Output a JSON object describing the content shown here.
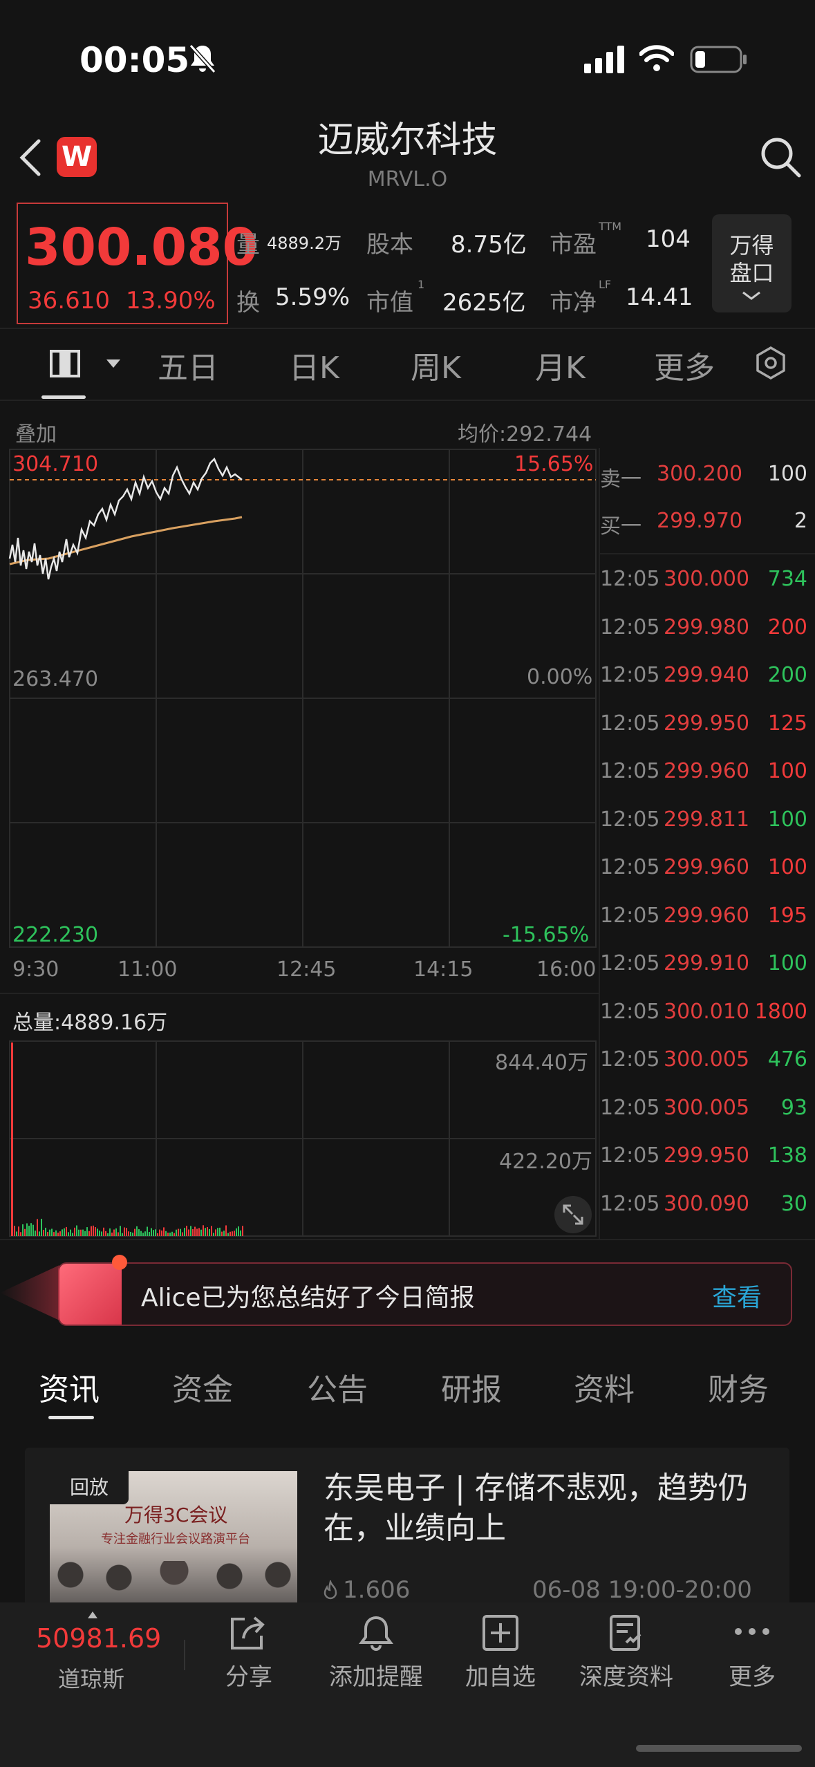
{
  "status": {
    "time": "00:05"
  },
  "header": {
    "title": "迈威尔科技",
    "ticker": "MRVL.O"
  },
  "quote": {
    "price": "300.080",
    "change": "36.610",
    "change_pct": "13.90%",
    "stats": {
      "volume_label": "量",
      "volume": "4889.2万",
      "shares_label": "股本",
      "shares": "8.75亿",
      "pe_label": "市盈",
      "pe_sup": "TTM",
      "pe": "104",
      "turnover_label": "换",
      "turnover": "5.59%",
      "mcap_label": "市值",
      "mcap_sup": "1",
      "mcap": "2625亿",
      "pb_label": "市净",
      "pb_sup": "LF",
      "pb": "14.41"
    },
    "panel_label": "万得\n盘口",
    "panel_line1": "万得",
    "panel_line2": "盘口"
  },
  "period_tabs": [
    "五日",
    "日K",
    "周K",
    "月K",
    "更多"
  ],
  "chart": {
    "overlay_label": "叠加",
    "avg_label": "均价:292.744",
    "y_high": "304.710",
    "y_mid": "263.470",
    "y_low": "222.230",
    "pct_high": "15.65%",
    "pct_mid": "0.00%",
    "pct_low": "-15.65%",
    "x_labels": [
      "9:30",
      "11:00",
      "12:45",
      "14:15",
      "16:00"
    ],
    "total_volume_label": "总量:4889.16万",
    "vol_high": "844.40万",
    "vol_mid": "422.20万"
  },
  "order_book": {
    "ask": {
      "label": "卖一",
      "price": "300.200",
      "volume": "100"
    },
    "bid": {
      "label": "买一",
      "price": "299.970",
      "volume": "2"
    },
    "trades": [
      {
        "time": "12:05",
        "price": "300.000",
        "volume": "734",
        "side": "buy"
      },
      {
        "time": "12:05",
        "price": "299.980",
        "volume": "200",
        "side": "sell"
      },
      {
        "time": "12:05",
        "price": "299.940",
        "volume": "200",
        "side": "buy"
      },
      {
        "time": "12:05",
        "price": "299.950",
        "volume": "125",
        "side": "sell"
      },
      {
        "time": "12:05",
        "price": "299.960",
        "volume": "100",
        "side": "sell"
      },
      {
        "time": "12:05",
        "price": "299.811",
        "volume": "100",
        "side": "buy"
      },
      {
        "time": "12:05",
        "price": "299.960",
        "volume": "100",
        "side": "sell"
      },
      {
        "time": "12:05",
        "price": "299.960",
        "volume": "195",
        "side": "sell"
      },
      {
        "time": "12:05",
        "price": "299.910",
        "volume": "100",
        "side": "buy"
      },
      {
        "time": "12:05",
        "price": "300.010",
        "volume": "1800",
        "side": "sell"
      },
      {
        "time": "12:05",
        "price": "300.005",
        "volume": "476",
        "side": "buy"
      },
      {
        "time": "12:05",
        "price": "300.005",
        "volume": "93",
        "side": "buy"
      },
      {
        "time": "12:05",
        "price": "299.950",
        "volume": "138",
        "side": "buy"
      },
      {
        "time": "12:05",
        "price": "300.090",
        "volume": "30",
        "side": "buy"
      }
    ]
  },
  "banner": {
    "text": "Alice已为您总结好了今日简报",
    "action": "查看"
  },
  "info_tabs": [
    "资讯",
    "资金",
    "公告",
    "研报",
    "资料",
    "财务"
  ],
  "news": {
    "badge": "回放",
    "thumb_title": "万得3C会议",
    "thumb_sub": "专注金融行业会议路演平台",
    "title": "东吴电子 | 存储不悲观，趋势仍在，业绩向上",
    "views": "1.606",
    "time": "06-08 19:00-20:00"
  },
  "bottom_bar": {
    "index_value": "50981.69",
    "index_name": "道琼斯",
    "items": [
      "分享",
      "添加提醒",
      "加自选",
      "深度资料",
      "更多"
    ]
  },
  "colors": {
    "up": "#f23a3a",
    "down": "#2ec35c",
    "accent": "#2aa6d6",
    "bg": "#141414"
  }
}
